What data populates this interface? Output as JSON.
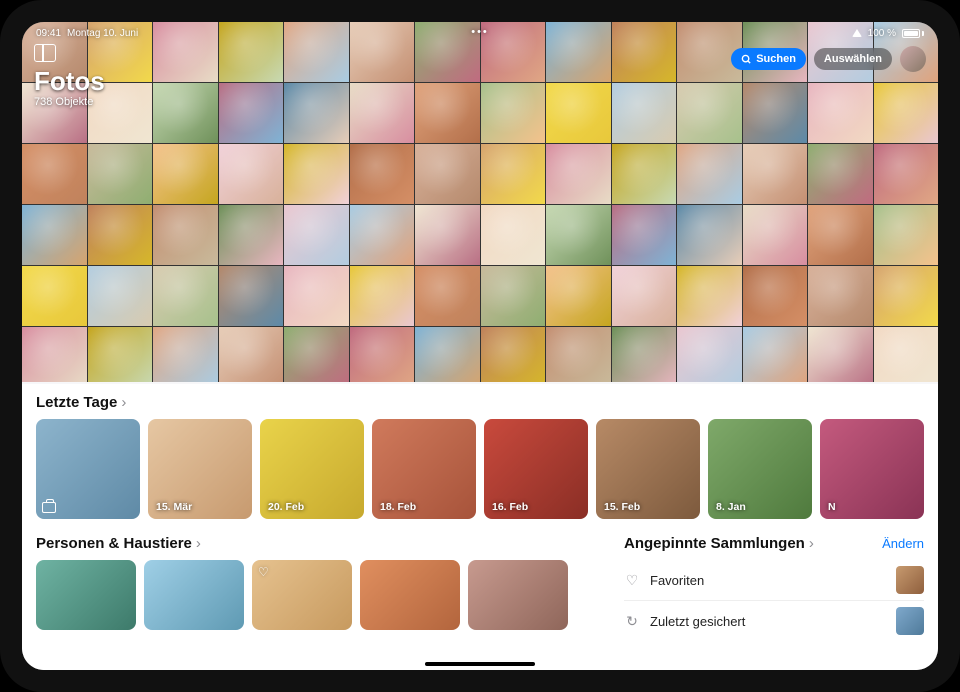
{
  "status": {
    "time": "09:41",
    "date": "Montag 10. Juni",
    "battery_pct": "100 %"
  },
  "header": {
    "title": "Fotos",
    "count_label": "738 Objekte",
    "search_label": "Suchen",
    "select_label": "Auswählen"
  },
  "grid": {
    "rows": 6,
    "cols": 14,
    "palettes": [
      "#d8b19a",
      "#e7cdb8",
      "#c48f72",
      "#f2d9c3",
      "#e0a37c",
      "#b5896c",
      "#f4c28c",
      "#d6a46e",
      "#8fae71",
      "#6f915a",
      "#c7d9b3",
      "#a7c18c",
      "#e8b6c0",
      "#f1d1d9",
      "#d88ea0",
      "#c06b80",
      "#eac7d0",
      "#b96f84",
      "#f2d94b",
      "#e8c83b",
      "#d6b72a",
      "#c5a61f",
      "#7fb3d5",
      "#a9cce3",
      "#5d8aa8",
      "#b3cde0",
      "#d58f66",
      "#b36f4a",
      "#e0a784",
      "#c0825c",
      "#f0e6d2",
      "#e8dcc6",
      "#d8cbb0",
      "#c8ba9b"
    ]
  },
  "sections": {
    "recent_days": {
      "title": "Letzte Tage",
      "items": [
        {
          "label": "",
          "icon": "briefcase",
          "bg": [
            "#8db4cc",
            "#5f8aa6"
          ]
        },
        {
          "label": "15. Mär",
          "bg": [
            "#e6c7a3",
            "#c79a6f"
          ]
        },
        {
          "label": "20. Feb",
          "bg": [
            "#e9d34a",
            "#c7a92e"
          ]
        },
        {
          "label": "18. Feb",
          "bg": [
            "#d07a5c",
            "#a7533a"
          ]
        },
        {
          "label": "16. Feb",
          "bg": [
            "#c94a3d",
            "#8a2e25"
          ]
        },
        {
          "label": "15. Feb",
          "bg": [
            "#b78a66",
            "#7d5a3d"
          ]
        },
        {
          "label": "8. Jan",
          "bg": [
            "#7fa96a",
            "#4f7a3d"
          ]
        },
        {
          "label": "N",
          "bg": [
            "#c45a7e",
            "#8a3355"
          ]
        }
      ]
    },
    "people_pets": {
      "title": "Personen & Haustiere",
      "items": [
        {
          "name": "",
          "bg": [
            "#6fb3a3",
            "#3d7a6a"
          ]
        },
        {
          "name": "",
          "bg": [
            "#9fcfe6",
            "#5f9ab3"
          ]
        },
        {
          "fav": true,
          "bg": [
            "#e6c28f",
            "#c79a5f"
          ]
        },
        {
          "bg": [
            "#e08f5f",
            "#b3653d"
          ]
        },
        {
          "bg": [
            "#c79a8f",
            "#8f665a"
          ]
        }
      ]
    },
    "pinned": {
      "title": "Angepinnte Sammlungen",
      "edit_label": "Ändern",
      "items": [
        {
          "icon": "heart",
          "name": "Favoriten",
          "thumb": [
            "#c79a6f",
            "#8f5f3d"
          ]
        },
        {
          "icon": "clock",
          "name": "Zuletzt gesichert",
          "thumb": [
            "#7fa9cc",
            "#4f7a9a"
          ]
        }
      ]
    }
  }
}
